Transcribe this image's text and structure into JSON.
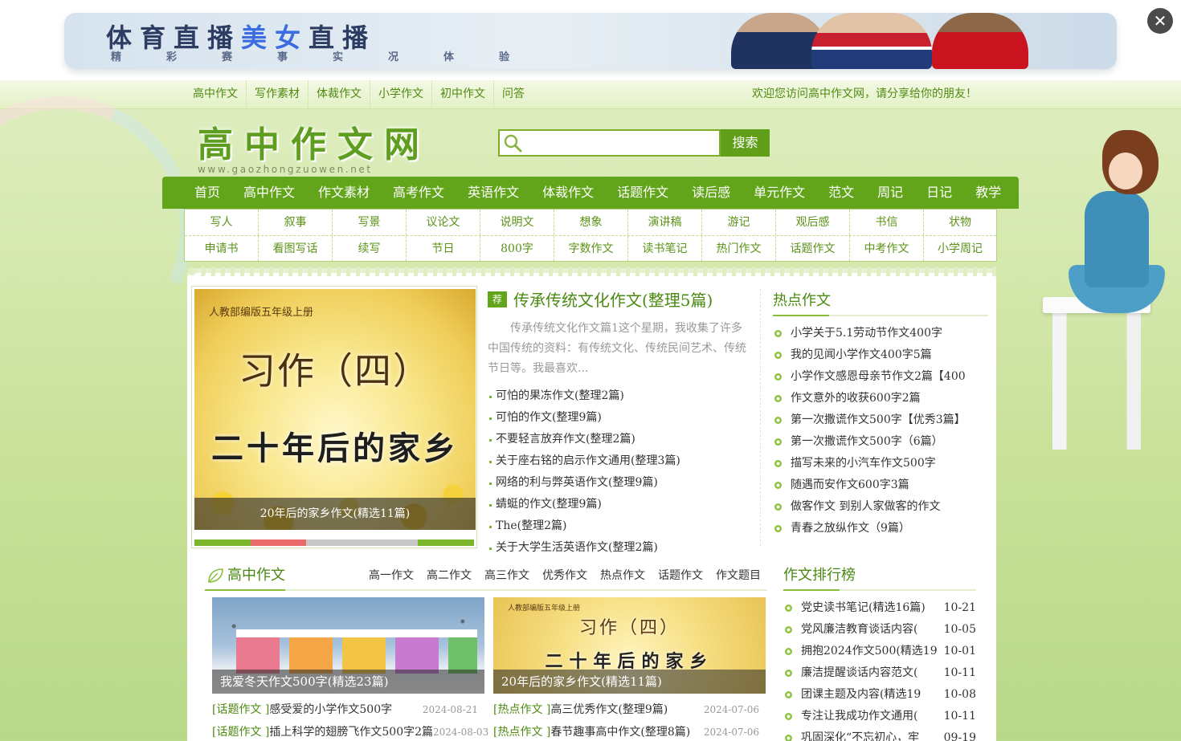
{
  "ad": {
    "title_a": "体育直播",
    "title_b": "美女",
    "title_c": "直播",
    "subtitle": "精彩赛事实况体验",
    "close_label": "✕"
  },
  "topnav": {
    "links": [
      "高中作文",
      "写作素材",
      "体裁作文",
      "小学作文",
      "初中作文",
      "问答"
    ],
    "welcome": "欢迎您访问高中作文网，请分享给你的朋友！"
  },
  "header": {
    "logo": "高中作文网",
    "logo_sub": "www.gaozhongzuowen.net",
    "search_placeholder": "",
    "search_button": "搜索"
  },
  "mainnav": [
    "首页",
    "高中作文",
    "作文素材",
    "高考作文",
    "英语作文",
    "体裁作文",
    "话题作文",
    "读后感",
    "单元作文",
    "范文",
    "周记",
    "日记",
    "教学"
  ],
  "subnav": {
    "row1": [
      "写人",
      "叙事",
      "写景",
      "议论文",
      "说明文",
      "想象",
      "演讲稿",
      "游记",
      "观后感",
      "书信",
      "状物"
    ],
    "row2": [
      "申请书",
      "看图写话",
      "续写",
      "节日",
      "800字",
      "字数作文",
      "读书笔记",
      "热门作文",
      "话题作文",
      "中考作文",
      "小学周记"
    ]
  },
  "slider": {
    "book": "人教部编版五年级上册",
    "chapter": "习作（四）",
    "big": "二十年后的家乡",
    "caption": "20年后的家乡作文(精选11篇)",
    "dot_colors": [
      "#7ab52c",
      "#e96a6a",
      "#c8c8c8",
      "#c8c8c8",
      "#7ab52c"
    ]
  },
  "featured": {
    "badge": "荐",
    "title": "传承传统文化作文(整理5篇)",
    "desc": "传承传统文化作文篇1这个星期，我收集了许多中国传统的资料：有传统文化、传统民间艺术、传统节日等。我最喜欢...",
    "list": [
      "可怕的果冻作文(整理2篇)",
      "可怕的作文(整理9篇)",
      "不要轻言放弃作文(整理2篇)",
      "关于座右铭的启示作文通用(整理3篇)",
      "网络的利与弊英语作文(整理9篇)",
      "蜻蜓的作文(整理9篇)",
      "The(整理2篇)",
      "关于大学生活英语作文(整理2篇)"
    ]
  },
  "hot": {
    "title": "热点作文",
    "list": [
      "小学关于5.1劳动节作文400字",
      "我的见闻小学作文400字5篇",
      "小学作文感恩母亲节作文2篇【400",
      "作文意外的收获600字2篇",
      "第一次撒谎作文500字【优秀3篇】",
      "第一次撒谎作文500字（6篇）",
      "描写未来的小汽车作文500字",
      "随遇而安作文600字3篇",
      "做客作文 到别人家做客的作文",
      "青春之放纵作文（9篇）"
    ]
  },
  "section": {
    "title": "高中作文",
    "tabs": [
      "高一作文",
      "高二作文",
      "高三作文",
      "优秀作文",
      "热点作文",
      "话题作文",
      "作文题目"
    ],
    "cards": [
      {
        "caption": "我爱冬天作文500字(精选23篇)",
        "items": [
          {
            "tag": "[话题作文 ]",
            "text": "感受爱的小学作文500字",
            "date": "2024-08-21"
          },
          {
            "tag": "[话题作文 ]",
            "text": "插上科学的翅膀飞作文500字2篇",
            "date": "2024-08-03"
          }
        ]
      },
      {
        "caption": "20年后的家乡作文(精选11篇)",
        "book": "人教部编版五年级上册",
        "t1": "习作（四）",
        "t2": "二十年后的家乡",
        "items": [
          {
            "tag": "[热点作文 ]",
            "text": "高三优秀作文(整理9篇)",
            "date": "2024-07-06"
          },
          {
            "tag": "[热点作文 ]",
            "text": "春节趣事高中作文(整理8篇)",
            "date": "2024-07-06"
          }
        ]
      }
    ]
  },
  "rank": {
    "title": "作文排行榜",
    "list": [
      {
        "text": "党史读书笔记(精选16篇)",
        "date": "10-21"
      },
      {
        "text": "党风廉洁教育谈话内容(",
        "date": "10-05"
      },
      {
        "text": "拥抱2024作文500(精选19",
        "date": "10-01"
      },
      {
        "text": "廉洁提醒谈话内容范文(",
        "date": "10-11"
      },
      {
        "text": "团课主题及内容(精选19",
        "date": "10-08"
      },
      {
        "text": "专注让我成功作文通用(",
        "date": "10-11"
      },
      {
        "text": "巩固深化“不忘初心，牢",
        "date": "09-19"
      }
    ]
  }
}
